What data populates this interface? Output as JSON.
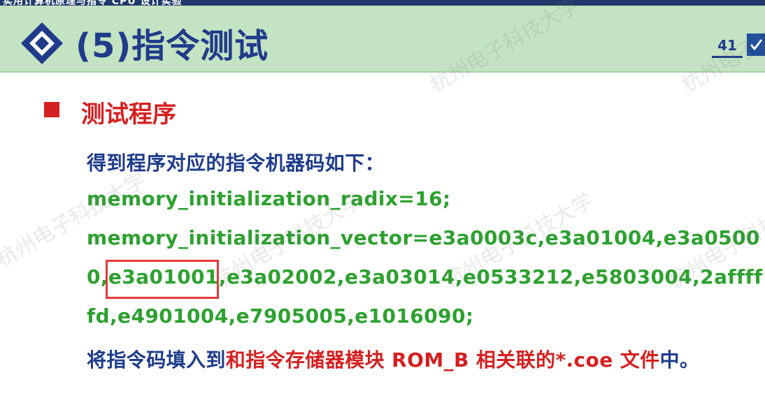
{
  "header": {
    "top_strip_text": "实用计算机原理与指令 CPU 设计实验",
    "title": "(5)指令测试",
    "page_number": "41"
  },
  "section": {
    "heading": "测试程序"
  },
  "body": {
    "intro": "得到程序对应的指令机器码如下：",
    "radix_line": "memory_initialization_radix=16;",
    "vector_line1": "memory_initialization_vector=e3a0003c,e3a01004,e3a0500",
    "vector_line2_pre": "0,",
    "vector_line2_highlight": "e3a01001",
    "vector_line2_post": ",e3a02002,e3a03014,e0533212,e5803004,2affff",
    "vector_line3": "fd,e4901004,e7905005,e1016090;",
    "final_blue1": "将指令码填入到",
    "final_red": "和指令存储器模块 ROM_B 相关联的*.coe 文件",
    "final_blue2": "中。"
  },
  "watermarks": {
    "org_name": "杭州电子科技大学"
  },
  "colors": {
    "title_blue": "#1f3b8a",
    "title_band_green": "#c4e3c2",
    "heading_red": "#d61f1f",
    "code_green": "#2da12f",
    "text_blue": "#1e3c8c",
    "highlight_red": "#e53a3a"
  },
  "icons": {
    "title_icon": "diamond-icon",
    "bullet_icon": "square-bullet-icon",
    "corner_icon": "check-box-icon"
  }
}
